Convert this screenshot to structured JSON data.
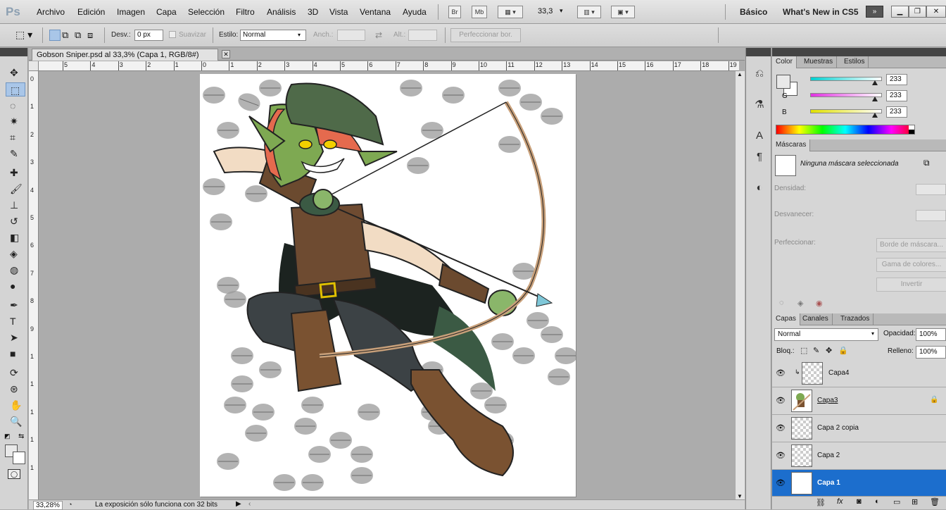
{
  "app": {
    "logo": "Ps"
  },
  "menu": [
    "Archivo",
    "Edición",
    "Imagen",
    "Capa",
    "Selección",
    "Filtro",
    "Análisis",
    "3D",
    "Vista",
    "Ventana",
    "Ayuda"
  ],
  "appbar": {
    "br": "Br",
    "mb": "Mb",
    "zoom": "33,3"
  },
  "workspaces": {
    "basic": "Básico",
    "whatsnew": "What's New in CS5"
  },
  "options": {
    "feather_label": "Desv.:",
    "feather_value": "0 px",
    "antialias_label": "Suavizar",
    "style_label": "Estilo:",
    "style_value": "Normal",
    "width_label": "Anch.:",
    "height_label": "Alt.:",
    "refine_button": "Perfeccionar bor."
  },
  "document": {
    "tab_title": "Gobson Sniper.psd al 33,3% (Capa 1, RGB/8#)",
    "ruler_h": [
      "5",
      "4",
      "3",
      "2",
      "1",
      "0",
      "1",
      "2",
      "3",
      "4",
      "5",
      "6",
      "7",
      "8",
      "9",
      "10",
      "11",
      "12",
      "13",
      "14",
      "15",
      "16",
      "17",
      "18",
      "19"
    ],
    "ruler_v": [
      "0",
      "1",
      "2",
      "3",
      "4",
      "5",
      "6",
      "7",
      "8",
      "9",
      "1",
      "1",
      "1",
      "1",
      "1"
    ]
  },
  "status": {
    "zoom": "33,28%",
    "message": "La exposición sólo funciona con 32 bits"
  },
  "color_panel": {
    "tabs": [
      "Color",
      "Muestras",
      "Estilos"
    ],
    "channels": [
      {
        "label": "R",
        "value": "233",
        "color": "#00c8c8"
      },
      {
        "label": "G",
        "value": "233",
        "color": "#e040e0"
      },
      {
        "label": "B",
        "value": "233",
        "color": "#e0e000"
      }
    ]
  },
  "masks_panel": {
    "title": "Máscaras",
    "status": "Ninguna máscara seleccionada",
    "density_label": "Densidad:",
    "feather_label": "Desvanecer:",
    "refine_label": "Perfeccionar:",
    "edge_button": "Borde de máscara...",
    "color_range_button": "Gama de colores...",
    "invert_button": "Invertir"
  },
  "layers_panel": {
    "tabs": [
      "Capas",
      "Canales",
      "Trazados"
    ],
    "blend_mode": "Normal",
    "opacity_label": "Opacidad:",
    "opacity_value": "100%",
    "lock_label": "Bloq.:",
    "fill_label": "Relleno:",
    "fill_value": "100%",
    "layers": [
      {
        "name": "Capa4",
        "selected": false
      },
      {
        "name": "Capa3",
        "selected": false
      },
      {
        "name": "Capa 2 copia",
        "selected": false
      },
      {
        "name": "Capa 2",
        "selected": false
      },
      {
        "name": "Capa 1",
        "selected": true
      }
    ]
  },
  "colors": {
    "selection": "#1c6ecd",
    "accent": "#3a5f8a"
  }
}
